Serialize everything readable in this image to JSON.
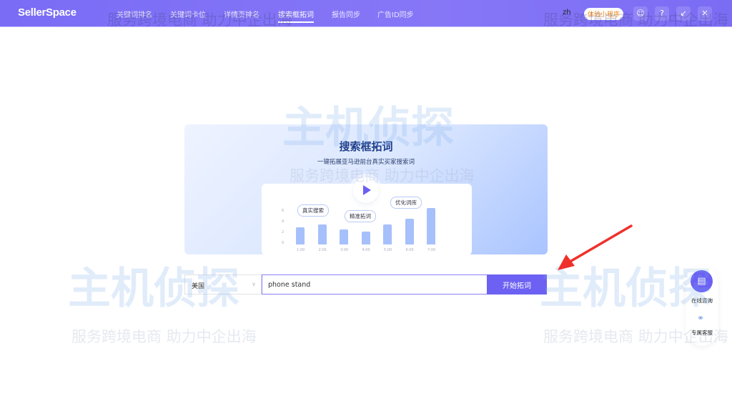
{
  "header": {
    "logo": "SellerSpace",
    "nav": [
      {
        "label": "关键词排名"
      },
      {
        "label": "关键词卡位"
      },
      {
        "label": "详情页排名"
      },
      {
        "label": "搜索框拓词",
        "active": true
      },
      {
        "label": "报告同步"
      },
      {
        "label": "广告ID同步"
      }
    ],
    "lang": "zh",
    "mini_program": "体验小程序"
  },
  "watermark": {
    "brand": "主机侦探",
    "slogan": "服务跨境电商 助力中企出海"
  },
  "banner": {
    "title": "搜索框拓词",
    "subtitle": "一键拓展亚马逊前台真实买家搜索词",
    "bubbles": [
      "真实搜索",
      "精准拓词",
      "优化词库"
    ],
    "chart_values": [
      3.3,
      3.8,
      2.9,
      2.5,
      3.8,
      5,
      7
    ],
    "x_labels": [
      "1:00",
      "2:00",
      "3:00",
      "4:00",
      "5:00",
      "6:00",
      "7:00"
    ],
    "y_labels": [
      "6",
      "4",
      "2",
      "0"
    ]
  },
  "search": {
    "country": "美国",
    "query": "phone stand",
    "button": "开始拓词"
  },
  "float": {
    "consult": "在线咨询",
    "service": "专属客服"
  },
  "colors": {
    "accent": "#6c61f2",
    "arrow": "#f0302a"
  }
}
